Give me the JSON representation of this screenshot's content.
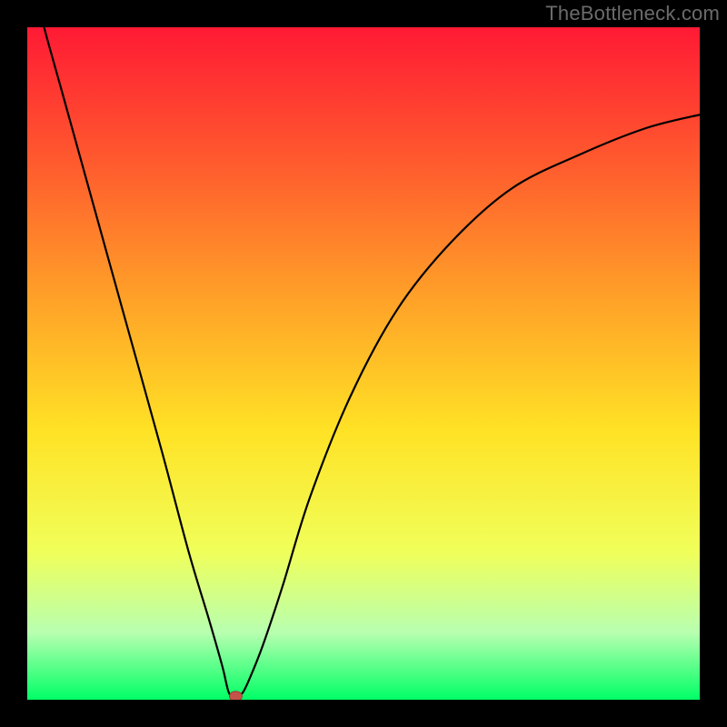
{
  "watermark": "TheBottleneck.com",
  "colors": {
    "frame": "#000000",
    "gradient_stops": [
      {
        "offset": 0.0,
        "color": "#ff1a34"
      },
      {
        "offset": 0.2,
        "color": "#ff5a2e"
      },
      {
        "offset": 0.4,
        "color": "#ffa028"
      },
      {
        "offset": 0.6,
        "color": "#ffe225"
      },
      {
        "offset": 0.78,
        "color": "#f0ff5a"
      },
      {
        "offset": 0.9,
        "color": "#b8ffb0"
      },
      {
        "offset": 1.0,
        "color": "#00ff66"
      }
    ],
    "curve": "#000000",
    "marker": "#c6534a"
  },
  "chart_data": {
    "type": "line",
    "title": "",
    "xlabel": "",
    "ylabel": "",
    "xlim": [
      0,
      1
    ],
    "ylim": [
      0,
      1
    ],
    "annotations": [],
    "series": [
      {
        "name": "curve",
        "x": [
          0.0,
          0.025,
          0.05,
          0.1,
          0.15,
          0.2,
          0.24,
          0.27,
          0.29,
          0.3,
          0.31,
          0.32,
          0.33,
          0.35,
          0.38,
          0.42,
          0.48,
          0.55,
          0.63,
          0.72,
          0.82,
          0.92,
          1.0
        ],
        "values": [
          1.1,
          1.0,
          0.91,
          0.73,
          0.55,
          0.37,
          0.22,
          0.12,
          0.05,
          0.01,
          0.005,
          0.01,
          0.03,
          0.08,
          0.17,
          0.3,
          0.45,
          0.58,
          0.68,
          0.76,
          0.81,
          0.85,
          0.87
        ]
      }
    ],
    "marker": {
      "x": 0.31,
      "y": 0.005
    }
  }
}
